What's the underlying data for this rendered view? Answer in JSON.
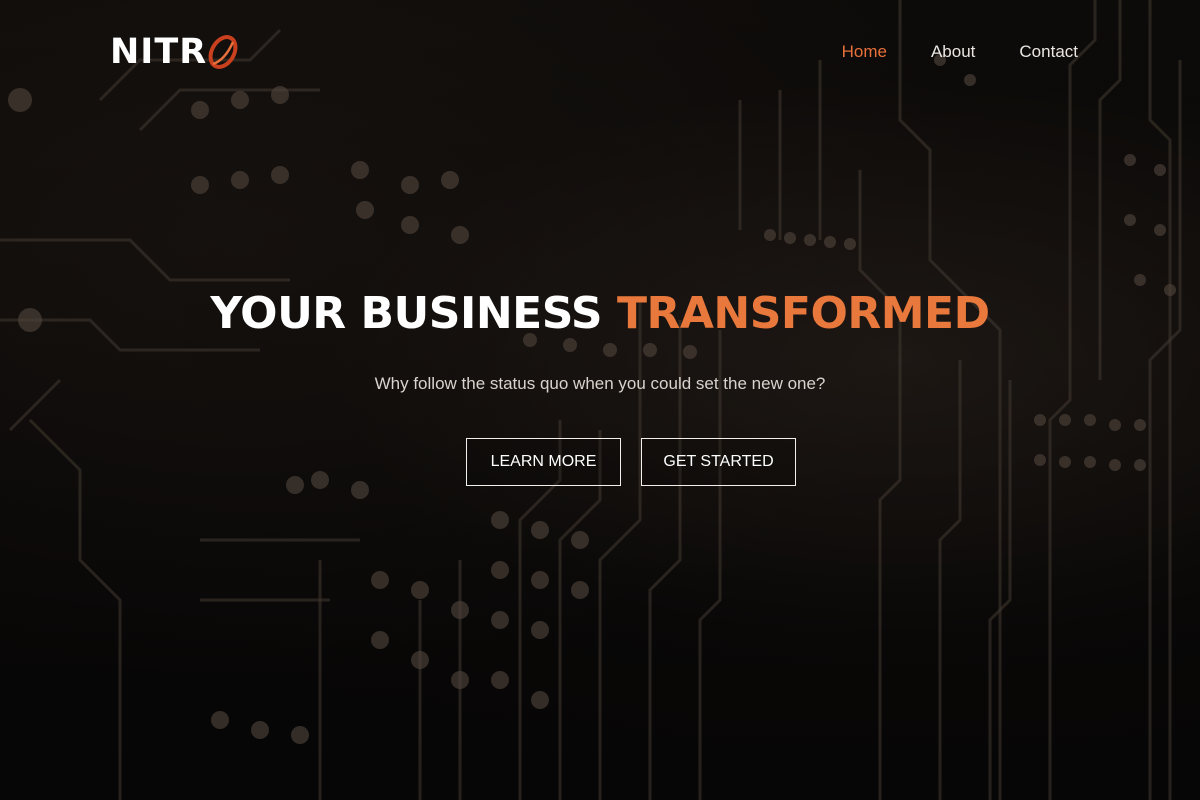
{
  "brand": {
    "logo_text": "NITR",
    "logo_mark": "O",
    "accent_color": "#e8703a"
  },
  "nav": {
    "items": [
      {
        "label": "Home",
        "active": true
      },
      {
        "label": "About",
        "active": false
      },
      {
        "label": "Contact",
        "active": false
      }
    ]
  },
  "hero": {
    "headline_part1": "YOUR BUSINESS ",
    "headline_part2": "TRANSFORMED",
    "subtitle": "Why follow the status quo when you could set the new one?",
    "buttons": {
      "learn_more": "LEARN MORE",
      "get_started": "GET STARTED"
    },
    "background": "circuit-board-image"
  }
}
